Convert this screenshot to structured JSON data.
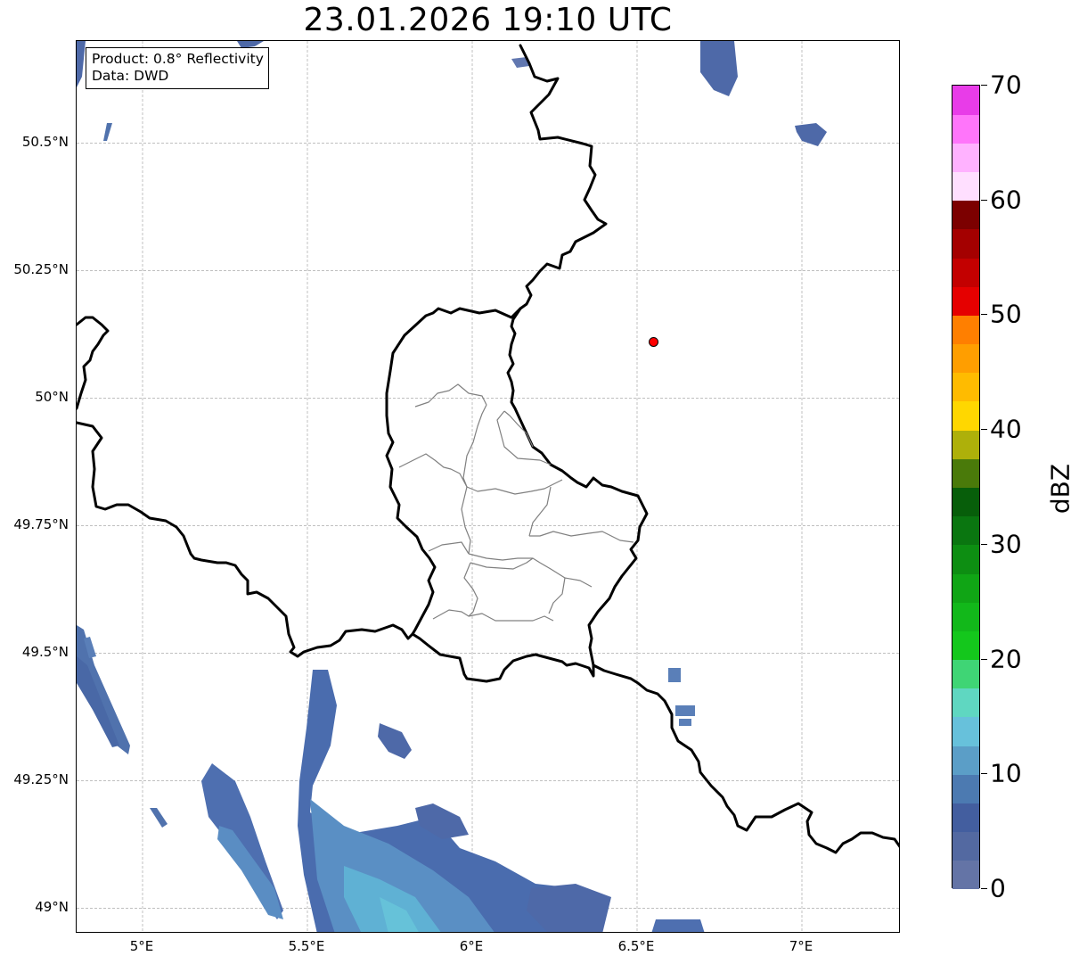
{
  "title": "23.01.2026 19:10 UTC",
  "info": {
    "product": "Product: 0.8° Reflectivity",
    "data_source": "Data: DWD"
  },
  "map_extent": {
    "lon_min": 4.8,
    "lon_max": 7.3,
    "lat_min": 48.95,
    "lat_max": 50.7
  },
  "lat_ticks": [
    {
      "value": 50.5,
      "label": "50.5°N"
    },
    {
      "value": 50.25,
      "label": "50.25°N"
    },
    {
      "value": 50.0,
      "label": "50°N"
    },
    {
      "value": 49.75,
      "label": "49.75°N"
    },
    {
      "value": 49.5,
      "label": "49.5°N"
    },
    {
      "value": 49.25,
      "label": "49.25°N"
    },
    {
      "value": 49.0,
      "label": "49°N"
    }
  ],
  "lon_ticks": [
    {
      "value": 5.0,
      "label": "5°E"
    },
    {
      "value": 5.5,
      "label": "5.5°E"
    },
    {
      "value": 6.0,
      "label": "6°E"
    },
    {
      "value": 6.5,
      "label": "6.5°E"
    },
    {
      "value": 7.0,
      "label": "7°E"
    }
  ],
  "radar_site": {
    "lon": 6.55,
    "lat": 50.11,
    "color": "#ff0000"
  },
  "colorbar": {
    "label": "dBZ",
    "min": 0,
    "max": 70,
    "ticks": [
      {
        "value": 0,
        "label": "0"
      },
      {
        "value": 10,
        "label": "10"
      },
      {
        "value": 20,
        "label": "20"
      },
      {
        "value": 30,
        "label": "30"
      },
      {
        "value": 40,
        "label": "40"
      },
      {
        "value": 50,
        "label": "50"
      },
      {
        "value": 60,
        "label": "60"
      },
      {
        "value": 70,
        "label": "70"
      }
    ],
    "colors": [
      "#6474a6",
      "#5369a1",
      "#435e9f",
      "#4c7ab1",
      "#5b9ec7",
      "#67c1db",
      "#5fd7c1",
      "#3fd575",
      "#14c71c",
      "#12b81a",
      "#10a515",
      "#0d8e12",
      "#0a7610",
      "#075e0a",
      "#4a7a0a",
      "#aeb00a",
      "#ffd700",
      "#ffbb00",
      "#ff9e00",
      "#ff7f00",
      "#e50000",
      "#c30000",
      "#a40000",
      "#7c0000",
      "#ffdfff",
      "#ffb2ff",
      "#ff75fa",
      "#e83ce8"
    ]
  },
  "features": {
    "border_color": "#000000",
    "canton_color": "#808080",
    "echo_colors": [
      "#6177b0",
      "#4e69a8",
      "#4a7cb5",
      "#5f9ecb",
      "#61bfd6"
    ]
  }
}
